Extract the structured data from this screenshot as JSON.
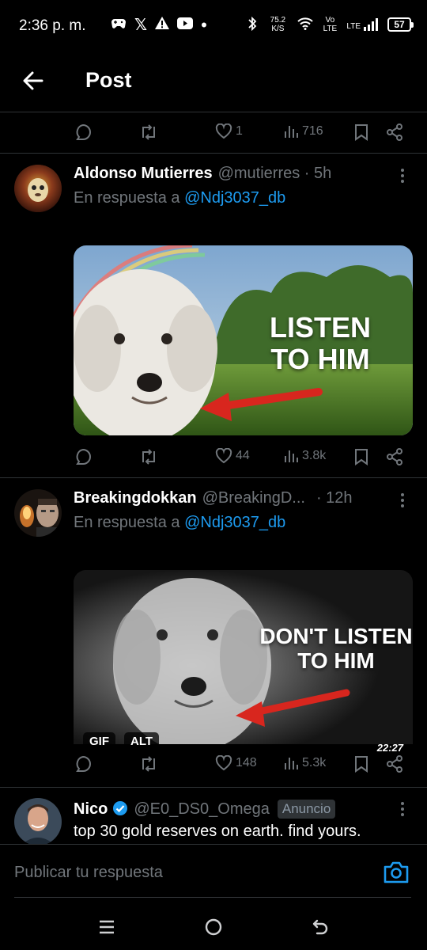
{
  "status_bar": {
    "time": "2:36 p. m.",
    "net_speed": "75.2 K/S",
    "network": "Vo LTE",
    "lte": "LTE",
    "battery": "57"
  },
  "header": {
    "title": "Post"
  },
  "top_actions": {
    "likes": "1",
    "views": "716"
  },
  "posts": [
    {
      "author": "Aldonso Mutierres",
      "handle": "@mutierres · 5h",
      "reply_prefix": "En respuesta a",
      "reply_mention": "@Ndj3037_db",
      "media_text": [
        "LISTEN",
        "TO HIM"
      ],
      "actions": {
        "likes": "44",
        "views": "3.8k"
      }
    },
    {
      "author": "Breakingdokkan",
      "handle": "@BreakingD...",
      "time": "· 12h",
      "reply_prefix": "En respuesta a",
      "reply_mention": "@Ndj3037_db",
      "media_text": [
        "DON'T LISTEN",
        "TO HIM"
      ],
      "badges": [
        "GIF",
        "ALT"
      ],
      "duration": "22:27",
      "actions": {
        "likes": "148",
        "views": "5.3k"
      }
    },
    {
      "author": "Nico",
      "handle": "@E0_DS0_Omega",
      "badge": "Anuncio",
      "text": "top 30 gold reserves on earth. find yours."
    }
  ],
  "composer": {
    "placeholder": "Publicar tu respuesta"
  },
  "colors": {
    "accent": "#1d9bf0",
    "muted": "#71767b",
    "background": "#000000"
  }
}
